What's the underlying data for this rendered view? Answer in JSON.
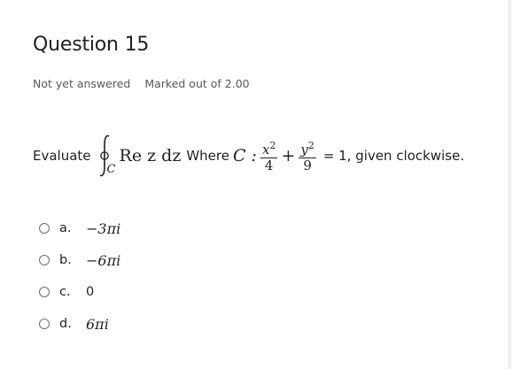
{
  "question": {
    "title": "Question 15",
    "status": "Not yet answered",
    "marks": "Marked out of 2.00",
    "prefix": "Evaluate",
    "integrand": "Re z dz",
    "middle": "Where",
    "contour_var": "C :",
    "sub": "C",
    "frac1_num": "x",
    "frac1_den": "4",
    "frac2_num": "y",
    "frac2_den": "9",
    "exp": "2",
    "plus": "+",
    "suffix": "= 1, given clockwise."
  },
  "options": [
    {
      "letter": "a.",
      "value": "−3πi"
    },
    {
      "letter": "b.",
      "value": "−6πi"
    },
    {
      "letter": "c.",
      "value": "0"
    },
    {
      "letter": "d.",
      "value": "6πi"
    }
  ]
}
